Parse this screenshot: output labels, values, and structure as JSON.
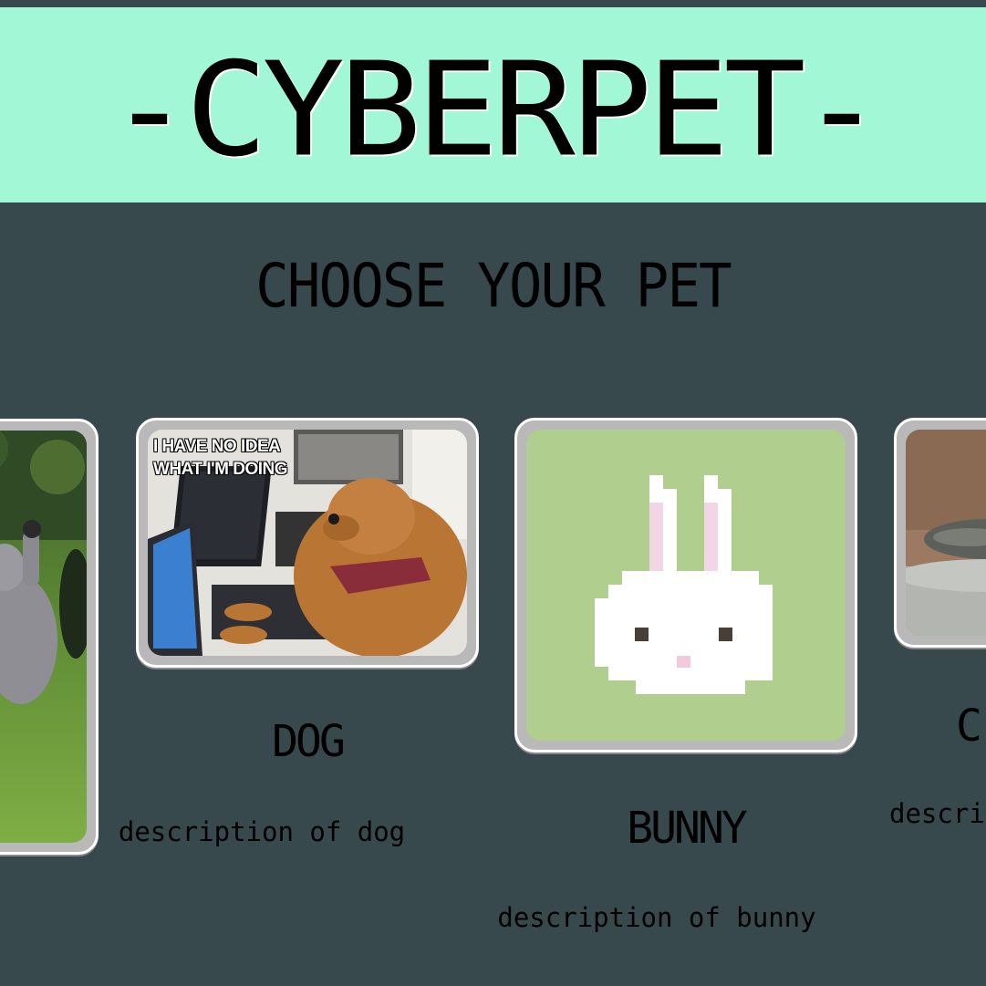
{
  "app": {
    "title": "-CYBERPET-"
  },
  "section": {
    "title": "CHOOSE YOUR PET"
  },
  "pets": [
    {
      "name": "",
      "description": ""
    },
    {
      "name": "DOG",
      "description": "description of dog",
      "image_caption": "I HAVE NO IDEA\nWHAT I'M DOING"
    },
    {
      "name": "BUNNY",
      "description": "description of bunny"
    },
    {
      "name": "C",
      "description": "descrip"
    }
  ],
  "colors": {
    "header_bg": "#a2f7d6",
    "page_bg": "#37494d",
    "card_frame": "#b9b9b9",
    "bunny_bg": "#b0cf8e"
  }
}
